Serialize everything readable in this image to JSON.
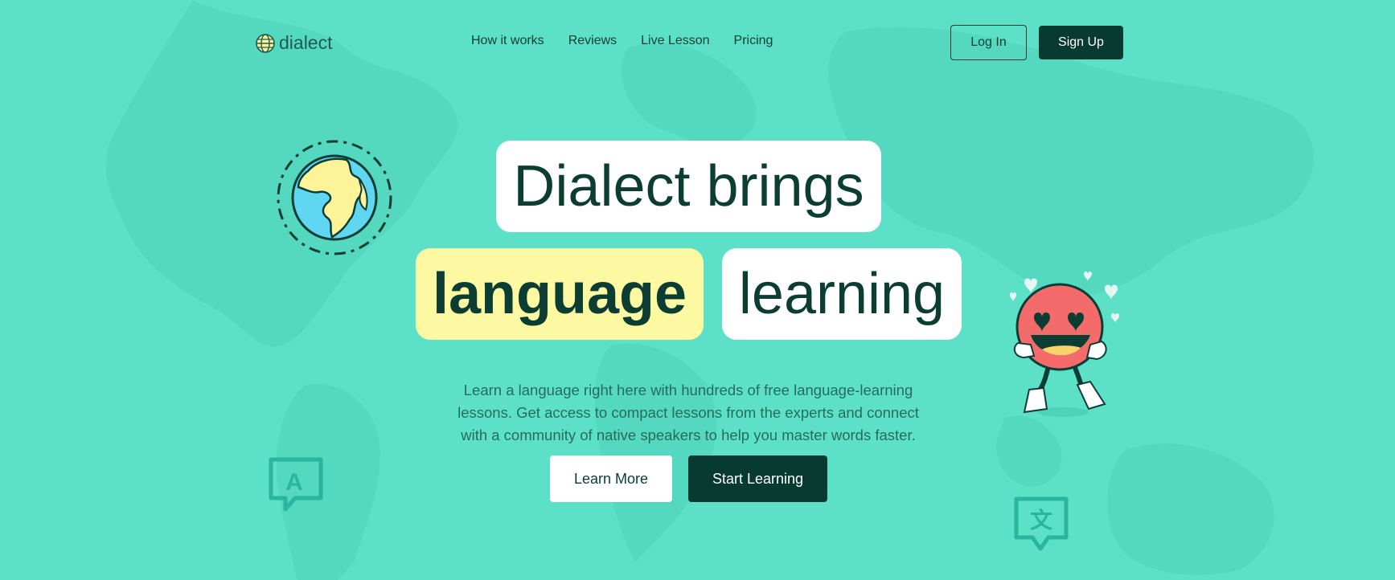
{
  "header": {
    "logo_text": "dialect",
    "nav": [
      {
        "label": "How it works"
      },
      {
        "label": "Reviews"
      },
      {
        "label": "Live Lesson"
      },
      {
        "label": "Pricing"
      }
    ],
    "login_label": "Log In",
    "signup_label": "Sign Up"
  },
  "hero": {
    "line1": "Dialect brings",
    "highlight": "language",
    "line2_rest": "learning",
    "description": "Learn a language right here with hundreds of free language-learning lessons. Get access to compact lessons from the experts and connect with a community of native speakers to help you master words faster.",
    "learn_more_label": "Learn More",
    "start_learning_label": "Start Learning"
  },
  "decorations": {
    "globe_icon": "globe-illustration",
    "mascot": "smiley-mascot-with-hearts",
    "bubble_left_glyph": "A",
    "bubble_right_glyph": "文"
  },
  "colors": {
    "background": "#5ce1c8",
    "dark": "#073a31",
    "highlight": "#fdf9a3",
    "mascot": "#f46b6b",
    "globe_land": "#fdf49a",
    "globe_water": "#5fd7f2"
  }
}
